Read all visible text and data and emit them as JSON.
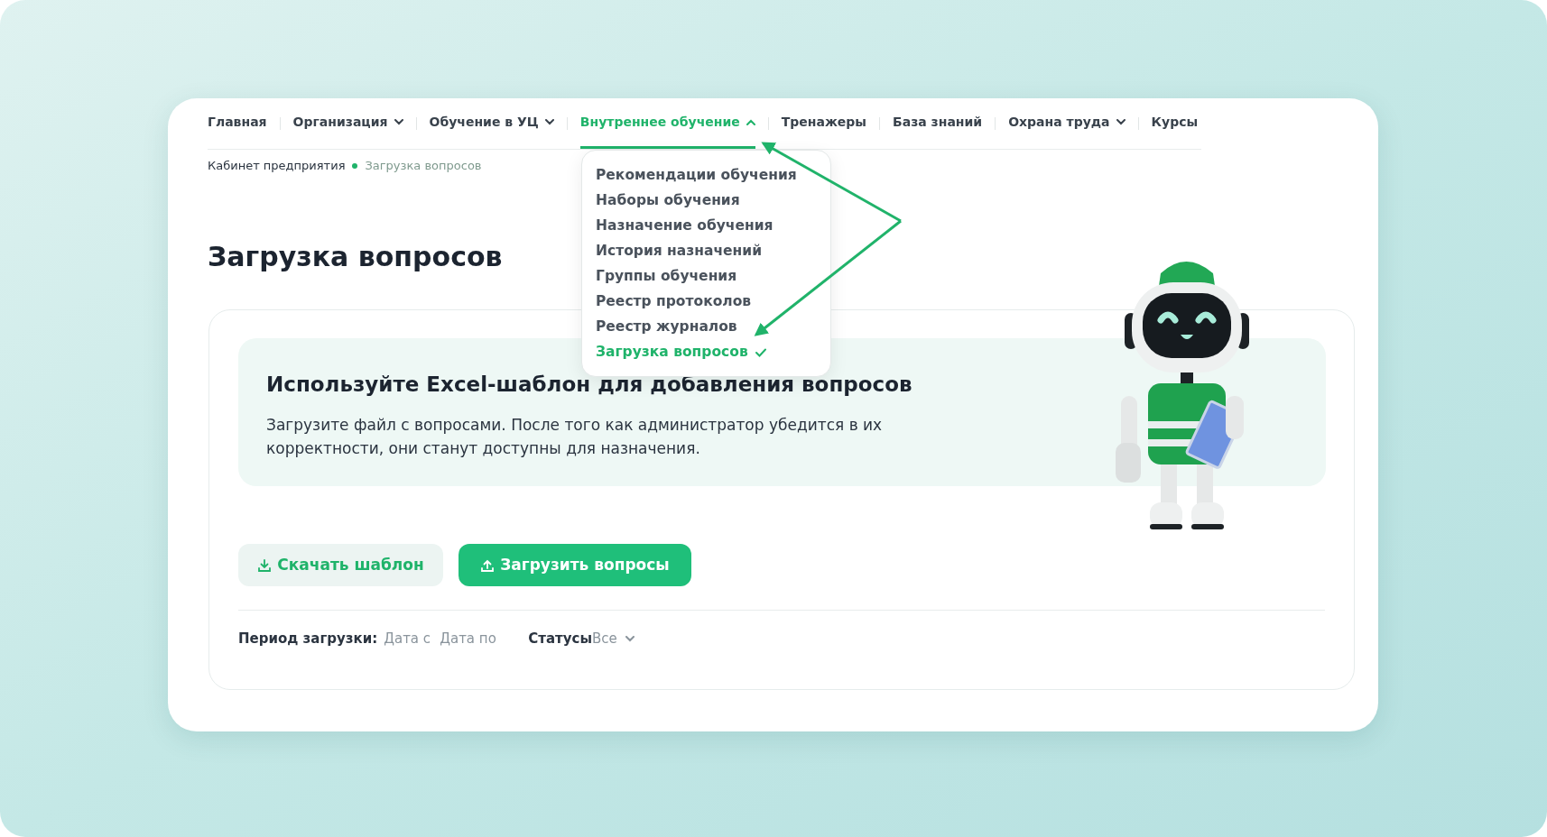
{
  "nav": [
    {
      "label": "Главная",
      "dropdown": false,
      "selected": false
    },
    {
      "label": "Организация",
      "dropdown": true,
      "selected": false,
      "expanded": false
    },
    {
      "label": "Обучение в УЦ",
      "dropdown": true,
      "selected": false,
      "expanded": false
    },
    {
      "label": "Внутреннее обучение",
      "dropdown": true,
      "selected": true,
      "expanded": true
    },
    {
      "label": "Тренажеры",
      "dropdown": false,
      "selected": false
    },
    {
      "label": "База знаний",
      "dropdown": false,
      "selected": false
    },
    {
      "label": "Охрана труда",
      "dropdown": true,
      "selected": false,
      "expanded": false
    },
    {
      "label": "Курсы",
      "dropdown": false,
      "selected": false
    }
  ],
  "dropdown_menu": [
    {
      "label": "Рекомендации обучения",
      "selected": false
    },
    {
      "label": "Наборы обучения",
      "selected": false
    },
    {
      "label": "Назначение обучения",
      "selected": false
    },
    {
      "label": "История назначений",
      "selected": false
    },
    {
      "label": "Группы обучения",
      "selected": false
    },
    {
      "label": "Реестр протоколов",
      "selected": false
    },
    {
      "label": "Реестр журналов",
      "selected": false
    },
    {
      "label": "Загрузка вопросов",
      "selected": true
    }
  ],
  "breadcrumbs": [
    "Кабинет предприятия",
    "Загрузка вопросов"
  ],
  "page_title": "Загрузка вопросов",
  "info": {
    "heading": "Используйте Excel-шаблон для добавления вопросов",
    "text": "Загрузите файл с вопросами. После того как администратор убедится в их корректности, они станут доступны для назначения."
  },
  "buttons": [
    {
      "kind": "secondary",
      "label": "Скачать шаблон"
    },
    {
      "kind": "primary",
      "label": "Загрузить вопросы"
    }
  ],
  "filters": {
    "period_label": "Период загрузки:",
    "date_from": {
      "placeholder": "Дата с"
    },
    "date_to": {
      "placeholder": "Дата по"
    },
    "status_label": "Статусы",
    "status_value": "Все"
  }
}
